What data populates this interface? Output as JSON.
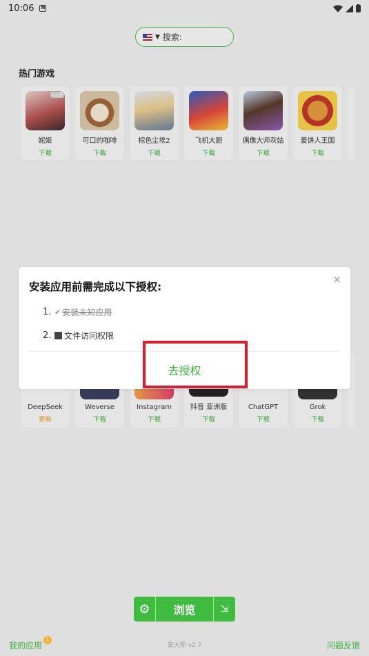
{
  "status_bar": {
    "time": "10:06"
  },
  "search": {
    "placeholder": "搜索:"
  },
  "hot_games": {
    "title": "热门游戏",
    "items": [
      {
        "name": "妮姬",
        "action": "下载",
        "tag": "GLB"
      },
      {
        "name": "可口的咖啡",
        "action": "下载"
      },
      {
        "name": "棕色尘埃2",
        "action": "下载"
      },
      {
        "name": "飞机大厨",
        "action": "下载"
      },
      {
        "name": "偶像大师灰姑",
        "action": "下载"
      },
      {
        "name": "姜饼人王国",
        "action": "下载"
      }
    ]
  },
  "apps": {
    "items": [
      {
        "name": "DeepSeek",
        "action": "更新"
      },
      {
        "name": "Weverse",
        "action": "下载"
      },
      {
        "name": "Instagram",
        "action": "下载"
      },
      {
        "name": "抖音 亚洲版",
        "action": "下载"
      },
      {
        "name": "ChatGPT",
        "action": "下载"
      },
      {
        "name": "Grok",
        "action": "下载"
      }
    ]
  },
  "dialog": {
    "title": "安装应用前需完成以下授权:",
    "close": "×",
    "steps": [
      {
        "num": "1.",
        "label": "安装未知应用"
      },
      {
        "num": "2.",
        "label": "文件访问权限"
      }
    ],
    "action": "去授权"
  },
  "bottom": {
    "browse_label": "浏览",
    "my_apps": "我的应用",
    "badge": "1",
    "version": "安大师 v2.7",
    "feedback": "问题反馈"
  },
  "colors": {
    "accent": "#3fbb3f",
    "highlight": "#e3192b",
    "update": "#e8a12a"
  }
}
